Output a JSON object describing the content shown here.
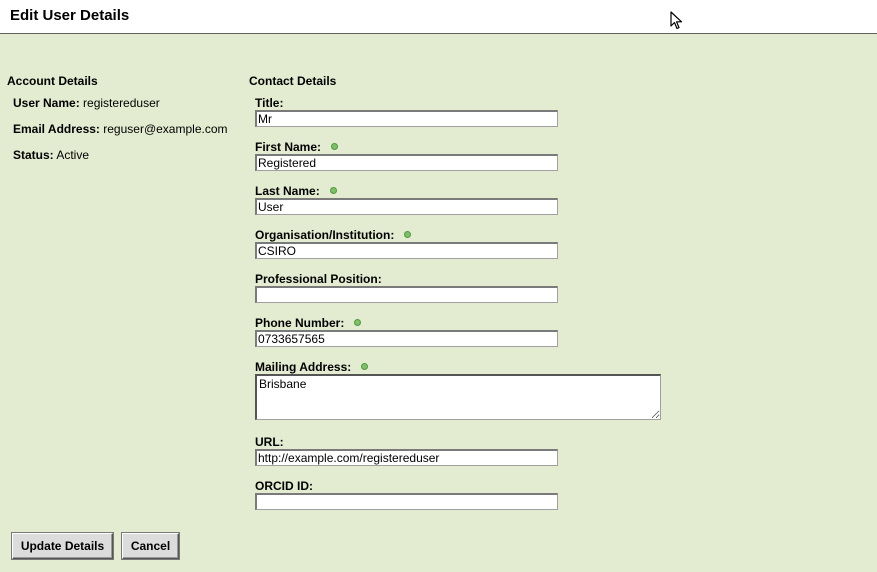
{
  "page": {
    "title": "Edit User Details"
  },
  "account": {
    "heading": "Account Details",
    "username_label": "User Name:",
    "username_value": "registereduser",
    "email_label": "Email Address:",
    "email_value": "reguser@example.com",
    "status_label": "Status:",
    "status_value": "Active"
  },
  "contact": {
    "heading": "Contact Details",
    "title": {
      "label": "Title:",
      "value": "Mr"
    },
    "first": {
      "label": "First Name:",
      "value": "Registered"
    },
    "last": {
      "label": "Last Name:",
      "value": "User"
    },
    "org": {
      "label": "Organisation/Institution:",
      "value": "CSIRO"
    },
    "position": {
      "label": "Professional Position:",
      "value": ""
    },
    "phone": {
      "label": "Phone Number:",
      "value": "0733657565"
    },
    "address": {
      "label": "Mailing Address:",
      "value": "Brisbane"
    },
    "url": {
      "label": "URL:",
      "value": "http://example.com/registereduser"
    },
    "orcid": {
      "label": "ORCID ID:",
      "value": ""
    }
  },
  "buttons": {
    "update": "Update Details",
    "cancel": "Cancel"
  },
  "colors": {
    "background": "#e3ecd0",
    "required_dot": "#7ec06a"
  }
}
